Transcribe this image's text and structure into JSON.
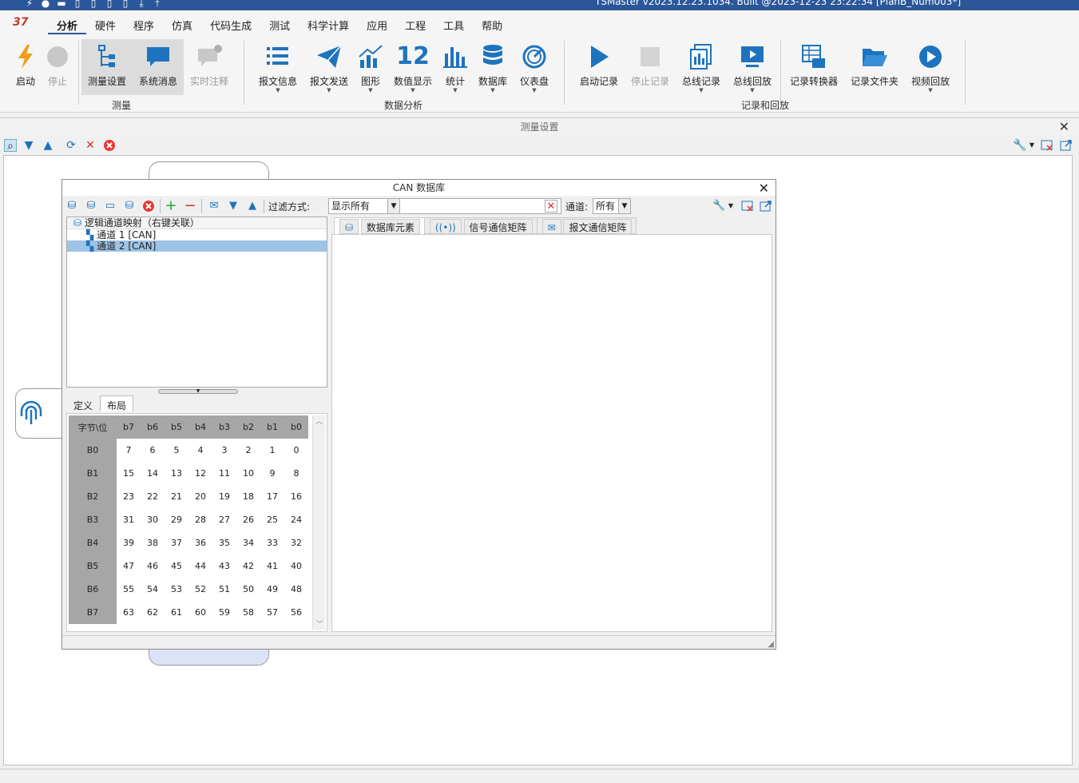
{
  "window": {
    "title": "TSMaster v2023.12.23.1034. Built @2023-12-23 23:22:34 [PlanB_Num003*]"
  },
  "menu": [
    "分析",
    "硬件",
    "程序",
    "仿真",
    "代码生成",
    "测试",
    "科学计算",
    "应用",
    "工程",
    "工具",
    "帮助"
  ],
  "ribbon": {
    "groups": {
      "measure": "测量",
      "analysis": "数据分析",
      "record": "记录和回放"
    },
    "buttons": {
      "start": "启动",
      "stop": "停止",
      "meas_setup": "测量设置",
      "sys_msg": "系统消息",
      "realtime_note": "实时注释",
      "msg_info": "报文信息",
      "msg_send": "报文发送",
      "graphics": "图形",
      "num_display": "数值显示",
      "stats": "统计",
      "database": "数据库",
      "dashboard": "仪表盘",
      "start_rec": "启动记录",
      "stop_rec": "停止记录",
      "bus_rec": "总线记录",
      "bus_replay": "总线回放",
      "rec_convert": "记录转换器",
      "rec_folder": "记录文件夹",
      "video_replay": "视频回放"
    },
    "num_icon_text": "12"
  },
  "panel": {
    "title": "测量设置"
  },
  "dialog": {
    "title": "CAN 数据库",
    "filter_label": "过滤方式:",
    "filter_value": "显示所有",
    "channel_label": "通道:",
    "channel_value": "所有",
    "tree": {
      "root": "逻辑通道映射（右键关联）",
      "items": [
        "通道 1 [CAN]",
        "通道 2 [CAN]"
      ]
    },
    "subtabs": [
      "定义",
      "布局"
    ],
    "layout": {
      "header": [
        "字节\\位",
        "b7",
        "b6",
        "b5",
        "b4",
        "b3",
        "b2",
        "b1",
        "b0"
      ],
      "rows": [
        {
          "label": "B0",
          "cells": [
            "7",
            "6",
            "5",
            "4",
            "3",
            "2",
            "1",
            "0"
          ]
        },
        {
          "label": "B1",
          "cells": [
            "15",
            "14",
            "13",
            "12",
            "11",
            "10",
            "9",
            "8"
          ]
        },
        {
          "label": "B2",
          "cells": [
            "23",
            "22",
            "21",
            "20",
            "19",
            "18",
            "17",
            "16"
          ]
        },
        {
          "label": "B3",
          "cells": [
            "31",
            "30",
            "29",
            "28",
            "27",
            "26",
            "25",
            "24"
          ]
        },
        {
          "label": "B4",
          "cells": [
            "39",
            "38",
            "37",
            "36",
            "35",
            "34",
            "33",
            "32"
          ]
        },
        {
          "label": "B5",
          "cells": [
            "47",
            "46",
            "45",
            "44",
            "43",
            "42",
            "41",
            "40"
          ]
        },
        {
          "label": "B6",
          "cells": [
            "55",
            "54",
            "53",
            "52",
            "51",
            "50",
            "49",
            "48"
          ]
        },
        {
          "label": "B7",
          "cells": [
            "63",
            "62",
            "61",
            "60",
            "59",
            "58",
            "57",
            "56"
          ]
        }
      ]
    },
    "right_tabs": [
      "数据库元素",
      "信号通信矩阵",
      "报文通信矩阵"
    ]
  },
  "colors": {
    "titlebar": "#2b579a",
    "accent_blue": "#1e73be",
    "selection": "#9dc3e6"
  }
}
